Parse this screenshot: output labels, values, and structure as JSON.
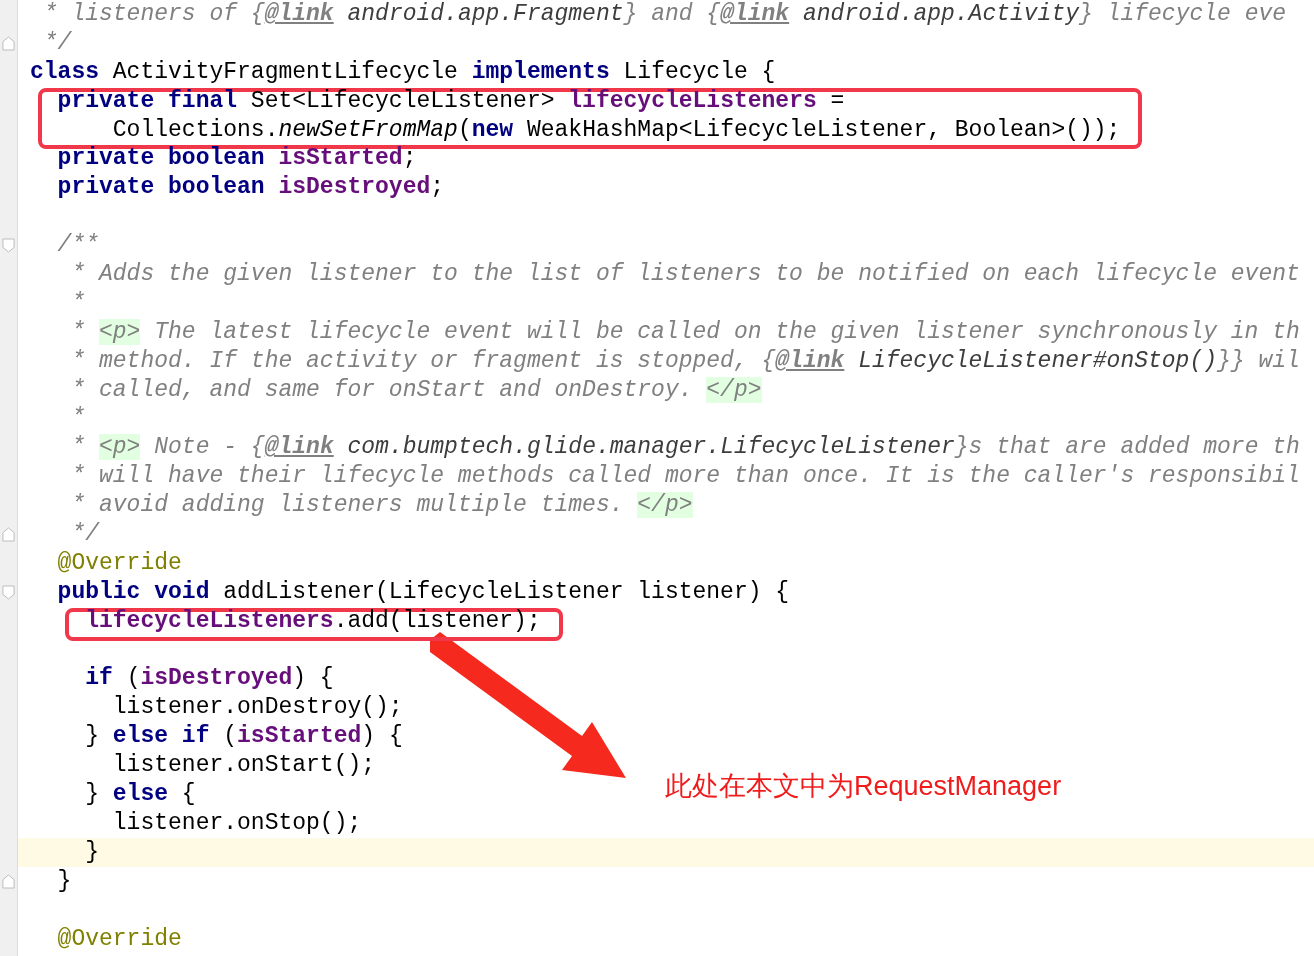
{
  "editor": {
    "lines": [
      {
        "tokens": [
          {
            "text": " * listeners of ",
            "kind": "comment"
          },
          {
            "text": "{",
            "kind": "comment"
          },
          {
            "text": "@link",
            "kind": "doclink"
          },
          {
            "text": " android.app.Fragment",
            "kind": "docref"
          },
          {
            "text": "} and {",
            "kind": "comment"
          },
          {
            "text": "@link",
            "kind": "doclink"
          },
          {
            "text": " android.app.Activity",
            "kind": "docref"
          },
          {
            "text": "} lifecycle eve",
            "kind": "comment"
          }
        ]
      },
      {
        "fold_end": true,
        "tokens": [
          {
            "text": " */",
            "kind": "comment"
          }
        ]
      },
      {
        "tokens": [
          {
            "text": "class",
            "kind": "keyword"
          },
          {
            "text": " ActivityFragmentLifecycle ",
            "kind": "plain"
          },
          {
            "text": "implements",
            "kind": "keyword"
          },
          {
            "text": " Lifecycle {",
            "kind": "plain"
          }
        ]
      },
      {
        "boxed": true,
        "tokens": [
          {
            "text": "  private final",
            "kind": "keyword"
          },
          {
            "text": " Set<LifecycleListener> ",
            "kind": "plain"
          },
          {
            "text": "lifecycleListeners",
            "kind": "field"
          },
          {
            "text": " =",
            "kind": "plain"
          }
        ]
      },
      {
        "boxed": true,
        "tokens": [
          {
            "text": "      Collections.",
            "kind": "plain"
          },
          {
            "text": "newSetFromMap",
            "kind": "static"
          },
          {
            "text": "(",
            "kind": "plain"
          },
          {
            "text": "new",
            "kind": "keyword"
          },
          {
            "text": " WeakHashMap<LifecycleListener, Boolean>());",
            "kind": "plain"
          }
        ]
      },
      {
        "tokens": [
          {
            "text": "  private boolean",
            "kind": "keyword"
          },
          {
            "text": " isStarted",
            "kind": "field"
          },
          {
            "text": ";",
            "kind": "plain"
          }
        ]
      },
      {
        "tokens": [
          {
            "text": "  private boolean",
            "kind": "keyword"
          },
          {
            "text": " isDestroyed",
            "kind": "field"
          },
          {
            "text": ";",
            "kind": "plain"
          }
        ]
      },
      {
        "blank_before": true,
        "fold_start": true,
        "tokens": [
          {
            "text": "  /**",
            "kind": "comment"
          }
        ]
      },
      {
        "tokens": [
          {
            "text": "   * Adds the given listener to the list of listeners to be notified on each lifecycle event",
            "kind": "comment"
          }
        ]
      },
      {
        "tokens": [
          {
            "text": "   *",
            "kind": "comment"
          }
        ]
      },
      {
        "tokens": [
          {
            "text": "   * ",
            "kind": "comment"
          },
          {
            "text": "<p>",
            "kind": "tag"
          },
          {
            "text": " The latest lifecycle event will be called on the given listener synchronously in th",
            "kind": "comment"
          }
        ]
      },
      {
        "tokens": [
          {
            "text": "   * method. If the activity or fragment is stopped, {",
            "kind": "comment"
          },
          {
            "text": "@link",
            "kind": "doclink"
          },
          {
            "text": " LifecycleListener#onStop()",
            "kind": "docref"
          },
          {
            "text": "}} wil",
            "kind": "comment"
          }
        ]
      },
      {
        "tokens": [
          {
            "text": "   * called, and same for onStart and onDestroy. ",
            "kind": "comment"
          },
          {
            "text": "</p>",
            "kind": "tag"
          }
        ]
      },
      {
        "tokens": [
          {
            "text": "   *",
            "kind": "comment"
          }
        ]
      },
      {
        "tokens": [
          {
            "text": "   * ",
            "kind": "comment"
          },
          {
            "text": "<p>",
            "kind": "tag"
          },
          {
            "text": " Note - {",
            "kind": "comment"
          },
          {
            "text": "@link",
            "kind": "doclink"
          },
          {
            "text": " com.bumptech.glide.manager.LifecycleListener",
            "kind": "docref"
          },
          {
            "text": "}s that are added more th",
            "kind": "comment"
          }
        ]
      },
      {
        "tokens": [
          {
            "text": "   * will have their lifecycle methods called more than once. It is the caller's responsibil",
            "kind": "comment"
          }
        ]
      },
      {
        "tokens": [
          {
            "text": "   * avoid adding listeners multiple times. ",
            "kind": "comment"
          },
          {
            "text": "</p>",
            "kind": "tag"
          }
        ]
      },
      {
        "fold_end": true,
        "tokens": [
          {
            "text": "   */",
            "kind": "comment"
          }
        ]
      },
      {
        "tokens": [
          {
            "text": "  @Override",
            "kind": "annotation"
          }
        ]
      },
      {
        "fold_start": true,
        "tokens": [
          {
            "text": "  public void",
            "kind": "keyword"
          },
          {
            "text": " addListener(LifecycleListener listener) {",
            "kind": "plain"
          }
        ]
      },
      {
        "boxed": true,
        "tokens": [
          {
            "text": "    lifecycleListeners",
            "kind": "field"
          },
          {
            "text": ".add(listener);",
            "kind": "plain"
          }
        ]
      },
      {
        "blank_before": true,
        "tokens": [
          {
            "text": "    if",
            "kind": "keyword"
          },
          {
            "text": " (",
            "kind": "plain"
          },
          {
            "text": "isDestroyed",
            "kind": "field"
          },
          {
            "text": ") {",
            "kind": "plain"
          }
        ]
      },
      {
        "tokens": [
          {
            "text": "      listener.onDestroy();",
            "kind": "plain"
          }
        ]
      },
      {
        "tokens": [
          {
            "text": "    } ",
            "kind": "plain"
          },
          {
            "text": "else if",
            "kind": "keyword"
          },
          {
            "text": " (",
            "kind": "plain"
          },
          {
            "text": "isStarted",
            "kind": "field"
          },
          {
            "text": ") {",
            "kind": "plain"
          }
        ]
      },
      {
        "tokens": [
          {
            "text": "      listener.onStart();",
            "kind": "plain"
          }
        ]
      },
      {
        "tokens": [
          {
            "text": "    } ",
            "kind": "plain"
          },
          {
            "text": "else",
            "kind": "keyword"
          },
          {
            "text": " {",
            "kind": "plain"
          }
        ]
      },
      {
        "tokens": [
          {
            "text": "      listener.onStop();",
            "kind": "plain"
          }
        ]
      },
      {
        "current": true,
        "tokens": [
          {
            "text": "    }",
            "kind": "plain"
          }
        ]
      },
      {
        "fold_end": true,
        "tokens": [
          {
            "text": "  }",
            "kind": "plain"
          }
        ]
      },
      {
        "blank_before": true,
        "tokens": [
          {
            "text": "  @Override",
            "kind": "annotation"
          }
        ]
      }
    ]
  },
  "callout": {
    "note": "此处在本文中为RequestManager"
  }
}
